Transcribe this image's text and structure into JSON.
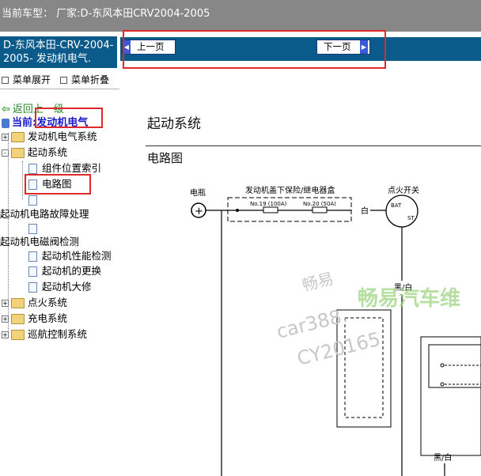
{
  "topbar": {
    "text": "当前车型：  厂家:D-东风本田CRV2004-2005"
  },
  "sidebar": {
    "header": "D-东风本田-CRV-2004-2005- 发动机电气.",
    "expand_label": "菜单展开",
    "collapse_label": "菜单折叠",
    "back_label": "返回上一级",
    "current_label": "当前:发动机电气",
    "tree": {
      "engine_electrical_system": "发动机电气系统",
      "starting_system": "起动系统",
      "component_index": "组件位置索引",
      "circuit_diagram": "电路图",
      "fault_handling": "起动机电路故障处理",
      "solenoid_test": "起动机电磁阀检测",
      "performance_test": "起动机性能检测",
      "replace": "起动机的更换",
      "overhaul": "起动机大修",
      "ignition_system": "点火系统",
      "charging_system": "充电系统",
      "cruise_control": "巡航控制系统"
    }
  },
  "nav": {
    "prev": "上一页",
    "next": "下一页"
  },
  "content": {
    "title": "起动系统",
    "subtitle": "电路图",
    "diagram": {
      "battery": "电瓶",
      "fuse_box": "发动机盖下保险/继电器盒",
      "fuse19": "No.19 (100A)",
      "fuse20": "No.20 (50A)",
      "white": "白",
      "ignition": "点火开关",
      "bat": "BAT",
      "st": "ST",
      "black_white": "黑/白",
      "black_white2": "黑/白"
    },
    "watermark": {
      "line1": "畅易",
      "line2": "car388.",
      "line3": "CY20165",
      "green": "畅易汽车维"
    }
  }
}
